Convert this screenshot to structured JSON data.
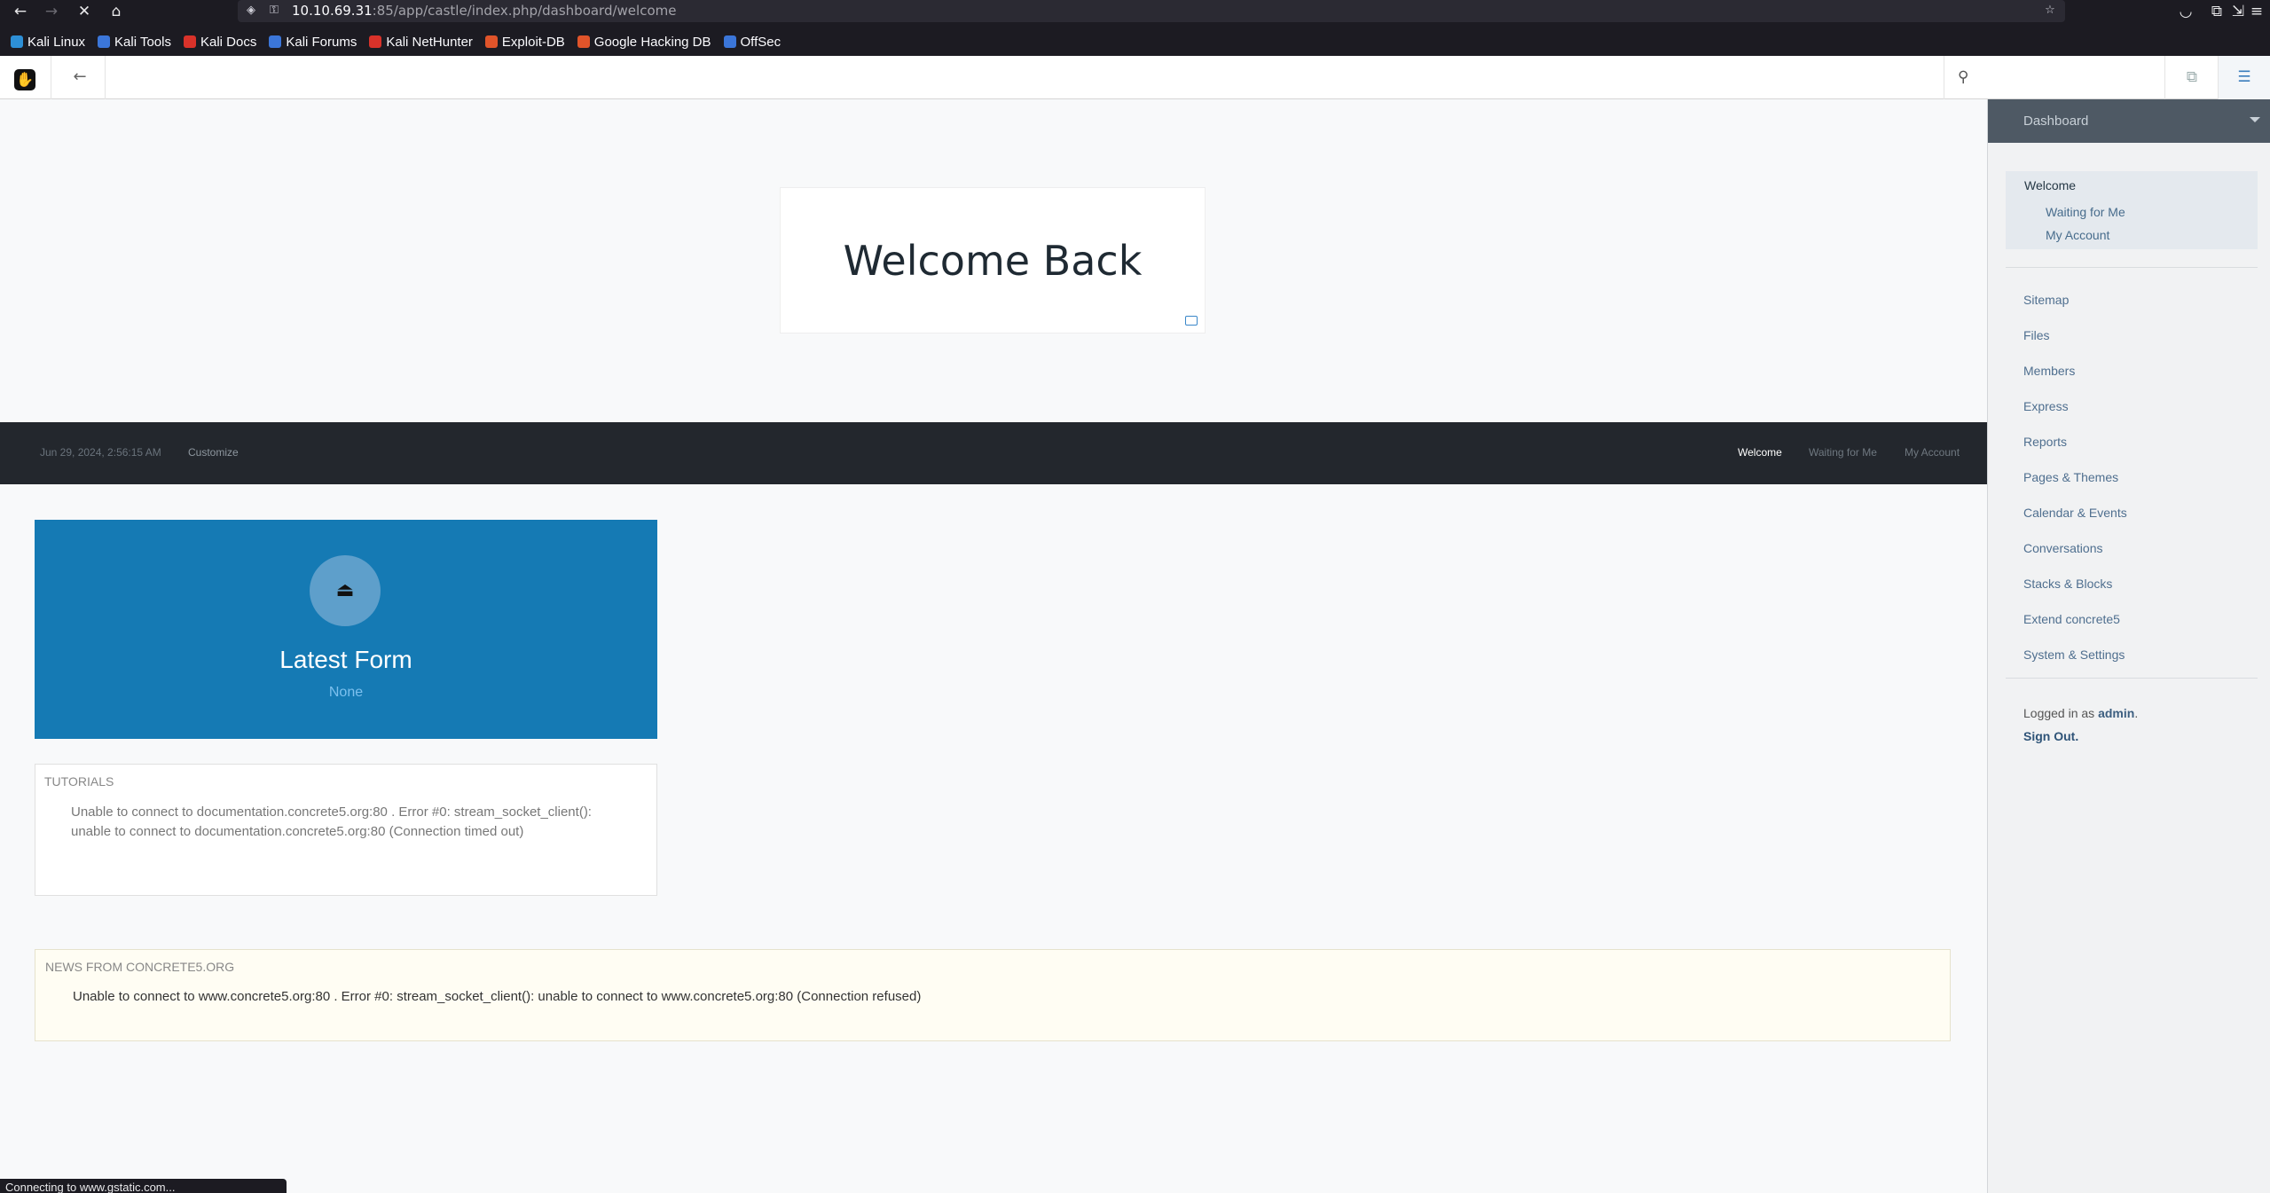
{
  "browser": {
    "url_host": "10.10.69.31",
    "url_rest": ":85/app/castle/index.php/dashboard/welcome",
    "bookmarks": [
      {
        "label": "Kali Linux",
        "color": "#2d8fd6"
      },
      {
        "label": "Kali Tools",
        "color": "#3b76d9"
      },
      {
        "label": "Kali Docs",
        "color": "#d9322a"
      },
      {
        "label": "Kali Forums",
        "color": "#3b76d9"
      },
      {
        "label": "Kali NetHunter",
        "color": "#d9322a"
      },
      {
        "label": "Exploit-DB",
        "color": "#e0542a"
      },
      {
        "label": "Google Hacking DB",
        "color": "#e0542a"
      },
      {
        "label": "OffSec",
        "color": "#3b76d9"
      }
    ],
    "status_text": "Connecting to www.gstatic.com..."
  },
  "toolbar": {
    "search_placeholder": ""
  },
  "welcome": {
    "title": "Welcome Back"
  },
  "darkbar": {
    "date": "Jun 29, 2024, 2:56:15 AM",
    "customize": "Customize",
    "nav": [
      "Welcome",
      "Waiting for Me",
      "My Account"
    ]
  },
  "form_tile": {
    "title": "Latest Form",
    "subtitle": "None",
    "color": "#157ab4"
  },
  "tutorials": {
    "label": "TUTORIALS",
    "message": "Unable to connect to documentation.concrete5.org:80 . Error #0: stream_socket_client(): unable to connect to documentation.concrete5.org:80 (Connection timed out)"
  },
  "news": {
    "label": "NEWS FROM CONCRETE5.ORG",
    "message": "Unable to connect to www.concrete5.org:80 . Error #0: stream_socket_client(): unable to connect to www.concrete5.org:80 (Connection refused)"
  },
  "panel": {
    "header": "Dashboard",
    "group_main": "Welcome",
    "group_subs": [
      "Waiting for Me",
      "My Account"
    ],
    "items": [
      "Sitemap",
      "Files",
      "Members",
      "Express",
      "Reports",
      "Pages & Themes",
      "Calendar & Events",
      "Conversations",
      "Stacks & Blocks",
      "Extend concrete5",
      "System & Settings"
    ],
    "logged_prefix": "Logged in as",
    "logged_user": "admin",
    "logged_suffix": ".",
    "sign_out": "Sign Out."
  }
}
